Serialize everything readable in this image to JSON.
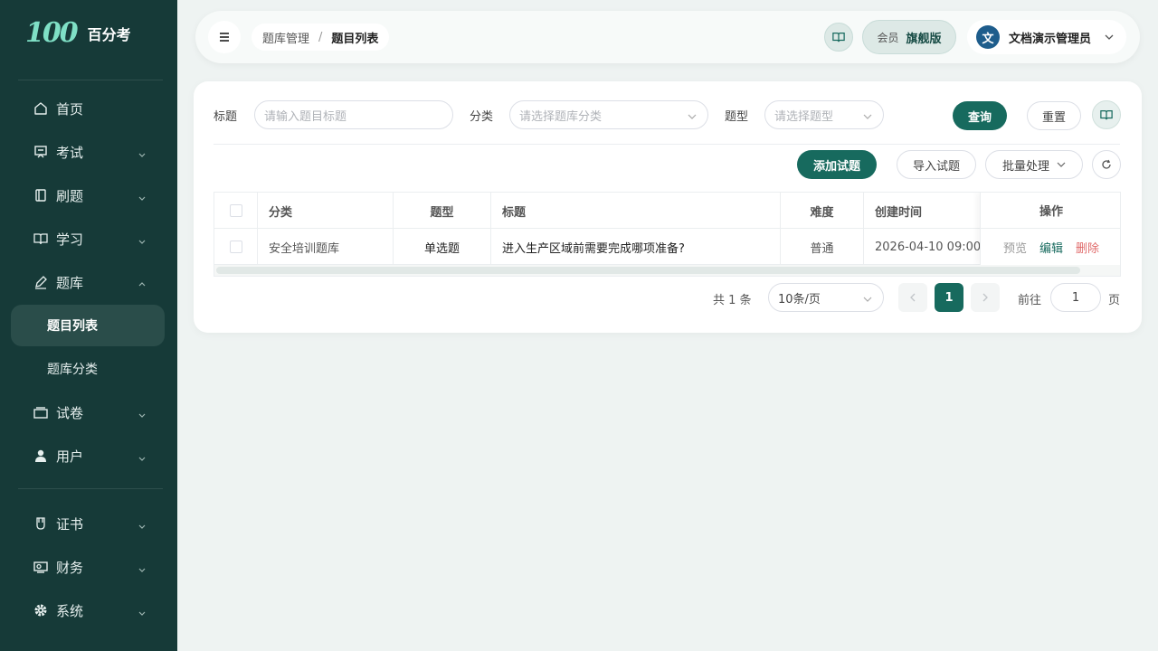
{
  "app": {
    "logo_mark": "100",
    "name": "百分考"
  },
  "sidebar": {
    "items": [
      {
        "label": "首页",
        "icon": "home-icon"
      },
      {
        "label": "考试",
        "icon": "exam-icon"
      },
      {
        "label": "刷题",
        "icon": "practice-icon"
      },
      {
        "label": "学习",
        "icon": "book-icon"
      },
      {
        "label": "题库",
        "icon": "pen-icon",
        "expanded": true
      },
      {
        "label": "题目列表",
        "active": true
      },
      {
        "label": "题库分类"
      },
      {
        "label": "试卷",
        "icon": "paper-icon"
      },
      {
        "label": "用户",
        "icon": "user-icon"
      },
      {
        "label": "证书",
        "icon": "certificate-icon"
      },
      {
        "label": "财务",
        "icon": "finance-icon"
      },
      {
        "label": "系统",
        "icon": "gear-icon"
      }
    ]
  },
  "topbar": {
    "breadcrumb": [
      "题库管理",
      "题目列表"
    ],
    "member_label": "会员",
    "member_plan": "旗舰版",
    "avatar_initial": "文",
    "user_name": "文档演示管理员"
  },
  "filters": {
    "title_label": "标题",
    "title_placeholder": "请输入题目标题",
    "category_label": "分类",
    "category_placeholder": "请选择题库分类",
    "type_label": "题型",
    "type_placeholder": "请选择题型",
    "search_button": "查询",
    "reset_button": "重置"
  },
  "toolbar": {
    "add_button": "添加试题",
    "import_button": "导入试题",
    "batch_button": "批量处理"
  },
  "table": {
    "columns": [
      "分类",
      "题型",
      "标题",
      "难度",
      "创建时间",
      "操作"
    ],
    "rows": [
      {
        "category": "安全培训题库",
        "type": "单选题",
        "title": "进入生产区域前需要完成哪项准备?",
        "difficulty": "普通",
        "created": "2026-04-10 09:00",
        "actions": {
          "preview": "预览",
          "edit": "编辑",
          "delete": "删除"
        }
      }
    ]
  },
  "pagination": {
    "total_text": "共 1 条",
    "page_size": "10条/页",
    "current_page": "1",
    "goto_label": "前往",
    "goto_value": "1",
    "page_suffix": "页"
  },
  "colors": {
    "sidebar_bg": "#163a38",
    "primary": "#176a5e",
    "danger": "#e06a6a",
    "background": "#eef3f2"
  }
}
